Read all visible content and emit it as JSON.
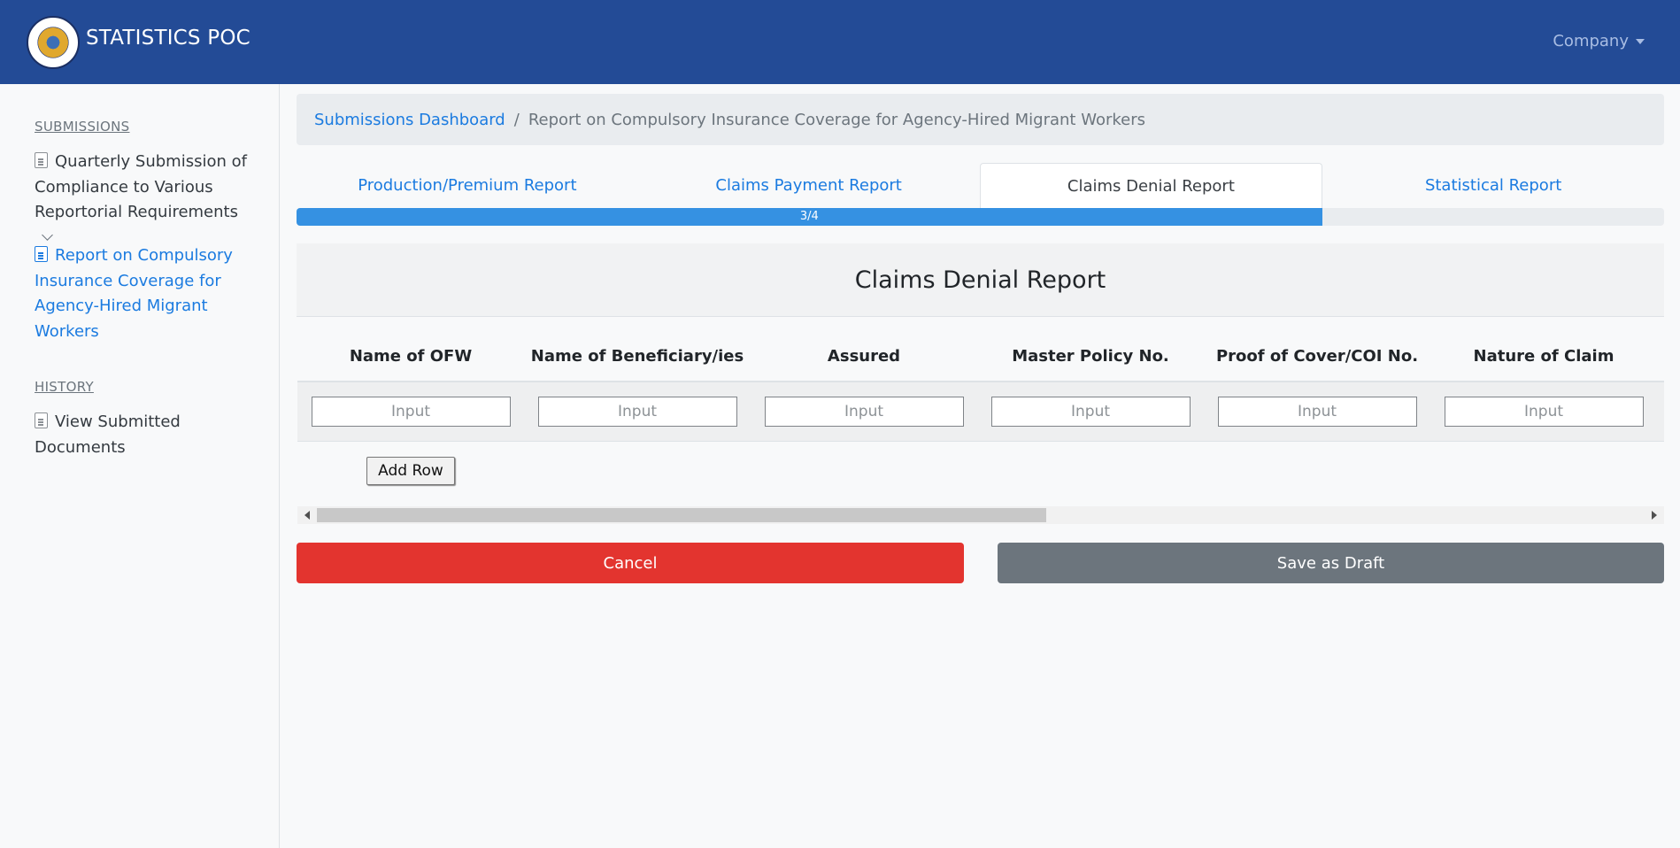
{
  "navbar": {
    "brand": "STATISTICS POC",
    "company_label": "Company",
    "logo_icon": "seal-logo-icon"
  },
  "sidebar": {
    "submissions_heading": "SUBMISSIONS",
    "items": [
      {
        "label": "Quarterly Submission of Compliance to Various Reportorial Requirements",
        "icon": "document-icon"
      },
      {
        "label": "Report on Compulsory Insurance Coverage for Agency-Hired Migrant Workers",
        "icon": "document-icon",
        "active": true
      }
    ],
    "history_heading": "HISTORY",
    "history_items": [
      {
        "label": "View Submitted Documents",
        "icon": "document-icon"
      }
    ]
  },
  "breadcrumb": {
    "link": "Submissions Dashboard",
    "separator": "/",
    "current": "Report on Compulsory Insurance Coverage for Agency-Hired Migrant Workers"
  },
  "tabs": [
    {
      "label": "Production/Premium Report"
    },
    {
      "label": "Claims Payment Report"
    },
    {
      "label": "Claims Denial Report",
      "active": true
    },
    {
      "label": "Statistical Report"
    }
  ],
  "progress": {
    "label": "3/4",
    "value": 0.75
  },
  "card": {
    "title": "Claims Denial Report"
  },
  "table": {
    "columns": [
      "Name of OFW",
      "Name of Beneficiary/ies",
      "Assured",
      "Master Policy No.",
      "Proof of Cover/COI No.",
      "Nature of Claim"
    ],
    "row_placeholder": "Input"
  },
  "actions": {
    "add_row": "Add Row",
    "cancel": "Cancel",
    "save_draft": "Save as Draft"
  },
  "colors": {
    "navbar": "#234b96",
    "link": "#1b7be0",
    "progress": "#3591e2",
    "cancel": "#e3342f",
    "draft": "#6c757d"
  }
}
